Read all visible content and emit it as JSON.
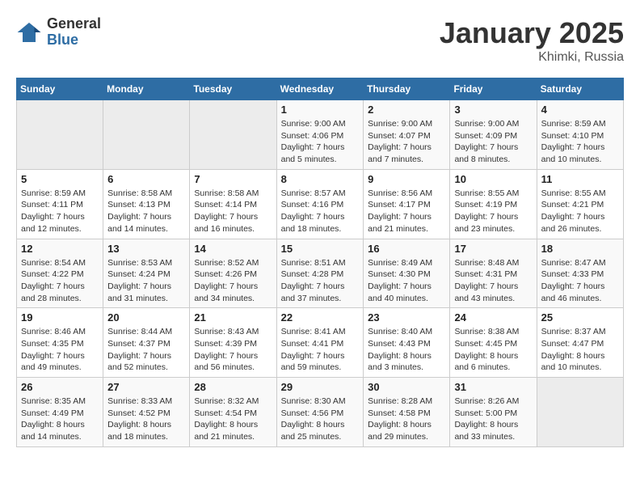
{
  "header": {
    "logo_general": "General",
    "logo_blue": "Blue",
    "title": "January 2025",
    "location": "Khimki, Russia"
  },
  "weekdays": [
    "Sunday",
    "Monday",
    "Tuesday",
    "Wednesday",
    "Thursday",
    "Friday",
    "Saturday"
  ],
  "weeks": [
    [
      {
        "day": "",
        "sunrise": "",
        "sunset": "",
        "daylight": ""
      },
      {
        "day": "",
        "sunrise": "",
        "sunset": "",
        "daylight": ""
      },
      {
        "day": "",
        "sunrise": "",
        "sunset": "",
        "daylight": ""
      },
      {
        "day": "1",
        "sunrise": "Sunrise: 9:00 AM",
        "sunset": "Sunset: 4:06 PM",
        "daylight": "Daylight: 7 hours and 5 minutes."
      },
      {
        "day": "2",
        "sunrise": "Sunrise: 9:00 AM",
        "sunset": "Sunset: 4:07 PM",
        "daylight": "Daylight: 7 hours and 7 minutes."
      },
      {
        "day": "3",
        "sunrise": "Sunrise: 9:00 AM",
        "sunset": "Sunset: 4:09 PM",
        "daylight": "Daylight: 7 hours and 8 minutes."
      },
      {
        "day": "4",
        "sunrise": "Sunrise: 8:59 AM",
        "sunset": "Sunset: 4:10 PM",
        "daylight": "Daylight: 7 hours and 10 minutes."
      }
    ],
    [
      {
        "day": "5",
        "sunrise": "Sunrise: 8:59 AM",
        "sunset": "Sunset: 4:11 PM",
        "daylight": "Daylight: 7 hours and 12 minutes."
      },
      {
        "day": "6",
        "sunrise": "Sunrise: 8:58 AM",
        "sunset": "Sunset: 4:13 PM",
        "daylight": "Daylight: 7 hours and 14 minutes."
      },
      {
        "day": "7",
        "sunrise": "Sunrise: 8:58 AM",
        "sunset": "Sunset: 4:14 PM",
        "daylight": "Daylight: 7 hours and 16 minutes."
      },
      {
        "day": "8",
        "sunrise": "Sunrise: 8:57 AM",
        "sunset": "Sunset: 4:16 PM",
        "daylight": "Daylight: 7 hours and 18 minutes."
      },
      {
        "day": "9",
        "sunrise": "Sunrise: 8:56 AM",
        "sunset": "Sunset: 4:17 PM",
        "daylight": "Daylight: 7 hours and 21 minutes."
      },
      {
        "day": "10",
        "sunrise": "Sunrise: 8:55 AM",
        "sunset": "Sunset: 4:19 PM",
        "daylight": "Daylight: 7 hours and 23 minutes."
      },
      {
        "day": "11",
        "sunrise": "Sunrise: 8:55 AM",
        "sunset": "Sunset: 4:21 PM",
        "daylight": "Daylight: 7 hours and 26 minutes."
      }
    ],
    [
      {
        "day": "12",
        "sunrise": "Sunrise: 8:54 AM",
        "sunset": "Sunset: 4:22 PM",
        "daylight": "Daylight: 7 hours and 28 minutes."
      },
      {
        "day": "13",
        "sunrise": "Sunrise: 8:53 AM",
        "sunset": "Sunset: 4:24 PM",
        "daylight": "Daylight: 7 hours and 31 minutes."
      },
      {
        "day": "14",
        "sunrise": "Sunrise: 8:52 AM",
        "sunset": "Sunset: 4:26 PM",
        "daylight": "Daylight: 7 hours and 34 minutes."
      },
      {
        "day": "15",
        "sunrise": "Sunrise: 8:51 AM",
        "sunset": "Sunset: 4:28 PM",
        "daylight": "Daylight: 7 hours and 37 minutes."
      },
      {
        "day": "16",
        "sunrise": "Sunrise: 8:49 AM",
        "sunset": "Sunset: 4:30 PM",
        "daylight": "Daylight: 7 hours and 40 minutes."
      },
      {
        "day": "17",
        "sunrise": "Sunrise: 8:48 AM",
        "sunset": "Sunset: 4:31 PM",
        "daylight": "Daylight: 7 hours and 43 minutes."
      },
      {
        "day": "18",
        "sunrise": "Sunrise: 8:47 AM",
        "sunset": "Sunset: 4:33 PM",
        "daylight": "Daylight: 7 hours and 46 minutes."
      }
    ],
    [
      {
        "day": "19",
        "sunrise": "Sunrise: 8:46 AM",
        "sunset": "Sunset: 4:35 PM",
        "daylight": "Daylight: 7 hours and 49 minutes."
      },
      {
        "day": "20",
        "sunrise": "Sunrise: 8:44 AM",
        "sunset": "Sunset: 4:37 PM",
        "daylight": "Daylight: 7 hours and 52 minutes."
      },
      {
        "day": "21",
        "sunrise": "Sunrise: 8:43 AM",
        "sunset": "Sunset: 4:39 PM",
        "daylight": "Daylight: 7 hours and 56 minutes."
      },
      {
        "day": "22",
        "sunrise": "Sunrise: 8:41 AM",
        "sunset": "Sunset: 4:41 PM",
        "daylight": "Daylight: 7 hours and 59 minutes."
      },
      {
        "day": "23",
        "sunrise": "Sunrise: 8:40 AM",
        "sunset": "Sunset: 4:43 PM",
        "daylight": "Daylight: 8 hours and 3 minutes."
      },
      {
        "day": "24",
        "sunrise": "Sunrise: 8:38 AM",
        "sunset": "Sunset: 4:45 PM",
        "daylight": "Daylight: 8 hours and 6 minutes."
      },
      {
        "day": "25",
        "sunrise": "Sunrise: 8:37 AM",
        "sunset": "Sunset: 4:47 PM",
        "daylight": "Daylight: 8 hours and 10 minutes."
      }
    ],
    [
      {
        "day": "26",
        "sunrise": "Sunrise: 8:35 AM",
        "sunset": "Sunset: 4:49 PM",
        "daylight": "Daylight: 8 hours and 14 minutes."
      },
      {
        "day": "27",
        "sunrise": "Sunrise: 8:33 AM",
        "sunset": "Sunset: 4:52 PM",
        "daylight": "Daylight: 8 hours and 18 minutes."
      },
      {
        "day": "28",
        "sunrise": "Sunrise: 8:32 AM",
        "sunset": "Sunset: 4:54 PM",
        "daylight": "Daylight: 8 hours and 21 minutes."
      },
      {
        "day": "29",
        "sunrise": "Sunrise: 8:30 AM",
        "sunset": "Sunset: 4:56 PM",
        "daylight": "Daylight: 8 hours and 25 minutes."
      },
      {
        "day": "30",
        "sunrise": "Sunrise: 8:28 AM",
        "sunset": "Sunset: 4:58 PM",
        "daylight": "Daylight: 8 hours and 29 minutes."
      },
      {
        "day": "31",
        "sunrise": "Sunrise: 8:26 AM",
        "sunset": "Sunset: 5:00 PM",
        "daylight": "Daylight: 8 hours and 33 minutes."
      },
      {
        "day": "",
        "sunrise": "",
        "sunset": "",
        "daylight": ""
      }
    ]
  ]
}
